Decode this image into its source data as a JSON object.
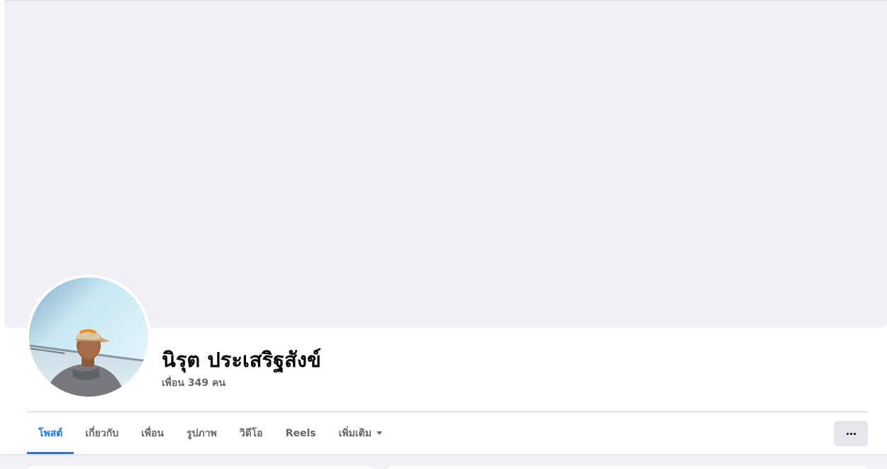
{
  "profile": {
    "name": "นิรุต ประเสริฐสังข์",
    "friends_text": "เพื่อน 349 คน"
  },
  "tabs": [
    {
      "label": "โพสต์",
      "active": true
    },
    {
      "label": "เกี่ยวกับ",
      "active": false
    },
    {
      "label": "เพื่อน",
      "active": false
    },
    {
      "label": "รูปภาพ",
      "active": false
    },
    {
      "label": "วิดีโอ",
      "active": false
    },
    {
      "label": "Reels",
      "active": false
    },
    {
      "label": "เพิ่มเติม",
      "active": false
    }
  ],
  "icons": {
    "more_tab": "chevron-down-icon",
    "options": "more-horizontal-icon"
  },
  "colors": {
    "accent": "#1877f2",
    "cover_bg": "#f0f1f5",
    "page_bg": "#f0f2f5",
    "text_primary": "#050505",
    "text_secondary": "#65676b"
  }
}
